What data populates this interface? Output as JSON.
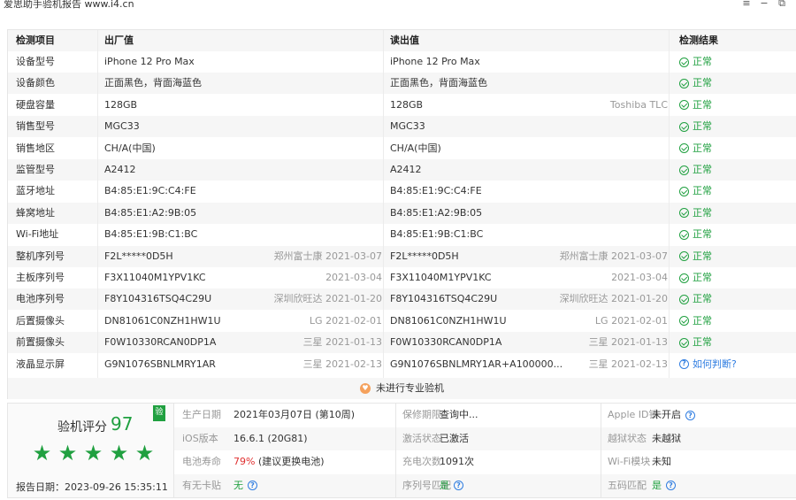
{
  "window": {
    "title": "爱思助手验机报告 www.i4.cn",
    "controls": [
      "≡",
      "−",
      "⧉"
    ]
  },
  "table": {
    "headers": [
      "检测项目",
      "出厂值",
      "读出值",
      "检测结果"
    ],
    "rows": [
      {
        "item": "设备型号",
        "factory": "iPhone 12 Pro Max",
        "factory_meta": "",
        "read": "iPhone 12 Pro Max",
        "read_meta": "",
        "result": "正常",
        "result_type": "ok"
      },
      {
        "item": "设备颜色",
        "factory": "正面黑色，背面海蓝色",
        "factory_meta": "",
        "read": "正面黑色，背面海蓝色",
        "read_meta": "",
        "result": "正常",
        "result_type": "ok"
      },
      {
        "item": "硬盘容量",
        "factory": "128GB",
        "factory_meta": "",
        "read": "128GB",
        "read_meta": "Toshiba TLC",
        "result": "正常",
        "result_type": "ok"
      },
      {
        "item": "销售型号",
        "factory": "MGC33",
        "factory_meta": "",
        "read": "MGC33",
        "read_meta": "",
        "result": "正常",
        "result_type": "ok"
      },
      {
        "item": "销售地区",
        "factory": "CH/A(中国)",
        "factory_meta": "",
        "read": "CH/A(中国)",
        "read_meta": "",
        "result": "正常",
        "result_type": "ok"
      },
      {
        "item": "监管型号",
        "factory": "A2412",
        "factory_meta": "",
        "read": "A2412",
        "read_meta": "",
        "result": "正常",
        "result_type": "ok"
      },
      {
        "item": "蓝牙地址",
        "factory": "B4:85:E1:9C:C4:FE",
        "factory_meta": "",
        "read": "B4:85:E1:9C:C4:FE",
        "read_meta": "",
        "result": "正常",
        "result_type": "ok"
      },
      {
        "item": "蜂窝地址",
        "factory": "B4:85:E1:A2:9B:05",
        "factory_meta": "",
        "read": "B4:85:E1:A2:9B:05",
        "read_meta": "",
        "result": "正常",
        "result_type": "ok"
      },
      {
        "item": "Wi-Fi地址",
        "factory": "B4:85:E1:9B:C1:BC",
        "factory_meta": "",
        "read": "B4:85:E1:9B:C1:BC",
        "read_meta": "",
        "result": "正常",
        "result_type": "ok"
      },
      {
        "item": "整机序列号",
        "factory": "F2L*****0D5H",
        "factory_meta": "郑州富士康 2021-03-07",
        "read": "F2L*****0D5H",
        "read_meta": "郑州富士康 2021-03-07",
        "result": "正常",
        "result_type": "ok"
      },
      {
        "item": "主板序列号",
        "factory": "F3X11040M1YPV1KC",
        "factory_meta": "2021-03-04",
        "read": "F3X11040M1YPV1KC",
        "read_meta": "2021-03-04",
        "result": "正常",
        "result_type": "ok"
      },
      {
        "item": "电池序列号",
        "factory": "F8Y104316TSQ4C29U",
        "factory_meta": "深圳欣旺达 2021-01-20",
        "read": "F8Y104316TSQ4C29U",
        "read_meta": "深圳欣旺达 2021-01-20",
        "result": "正常",
        "result_type": "ok"
      },
      {
        "item": "后置摄像头",
        "factory": "DN81061C0NZH1HW1U",
        "factory_meta": "LG 2021-02-01",
        "read": "DN81061C0NZH1HW1U",
        "read_meta": "LG 2021-02-01",
        "result": "正常",
        "result_type": "ok"
      },
      {
        "item": "前置摄像头",
        "factory": "F0W10330RCAN0DP1A",
        "factory_meta": "三星 2021-01-13",
        "read": "F0W10330RCAN0DP1A",
        "read_meta": "三星 2021-01-13",
        "result": "正常",
        "result_type": "ok"
      },
      {
        "item": "液晶显示屏",
        "factory": "G9N1076SBNLMRY1AR",
        "factory_meta": "三星 2021-02-13",
        "read": "G9N1076SBNLMRY1AR+A100000...",
        "read_meta": "三星 2021-02-13",
        "result": "如何判断?",
        "result_type": "question"
      }
    ],
    "notice": "未进行专业验机"
  },
  "summary": {
    "score_label": "验机评分",
    "score": "97",
    "badge": "验",
    "stars": 5,
    "report_date": "报告日期：2023-09-26 15:35:11",
    "info": [
      [
        {
          "label": "生产日期",
          "value": "2021年03月07日 (第10周)",
          "tone": "normal"
        },
        {
          "label": "保修期限",
          "value": "查询中...",
          "tone": "normal"
        },
        {
          "label": "Apple ID锁",
          "value": "未开启",
          "tone": "normal",
          "help": true
        }
      ],
      [
        {
          "label": "iOS版本",
          "value": "16.6.1 (20G81)",
          "tone": "normal"
        },
        {
          "label": "激活状态",
          "value": "已激活",
          "tone": "normal"
        },
        {
          "label": "越狱状态",
          "value": "未越狱",
          "tone": "normal"
        }
      ],
      [
        {
          "label": "电池寿命",
          "value": "79%",
          "value2": "(建议更换电池)",
          "tone": "red"
        },
        {
          "label": "充电次数",
          "value": "1091次",
          "tone": "normal"
        },
        {
          "label": "Wi-Fi模块",
          "value": "未知",
          "tone": "normal"
        }
      ],
      [
        {
          "label": "有无卡贴",
          "value": "无",
          "tone": "green",
          "help": true
        },
        {
          "label": "序列号匹配",
          "value": "是",
          "tone": "green",
          "help": true
        },
        {
          "label": "五码匹配",
          "value": "是",
          "tone": "green",
          "help": true
        }
      ]
    ]
  },
  "colors": {
    "ok": "#20a040",
    "link": "#2f7de1",
    "warn": "#e03030",
    "notice_icon": "#f5a15c"
  }
}
